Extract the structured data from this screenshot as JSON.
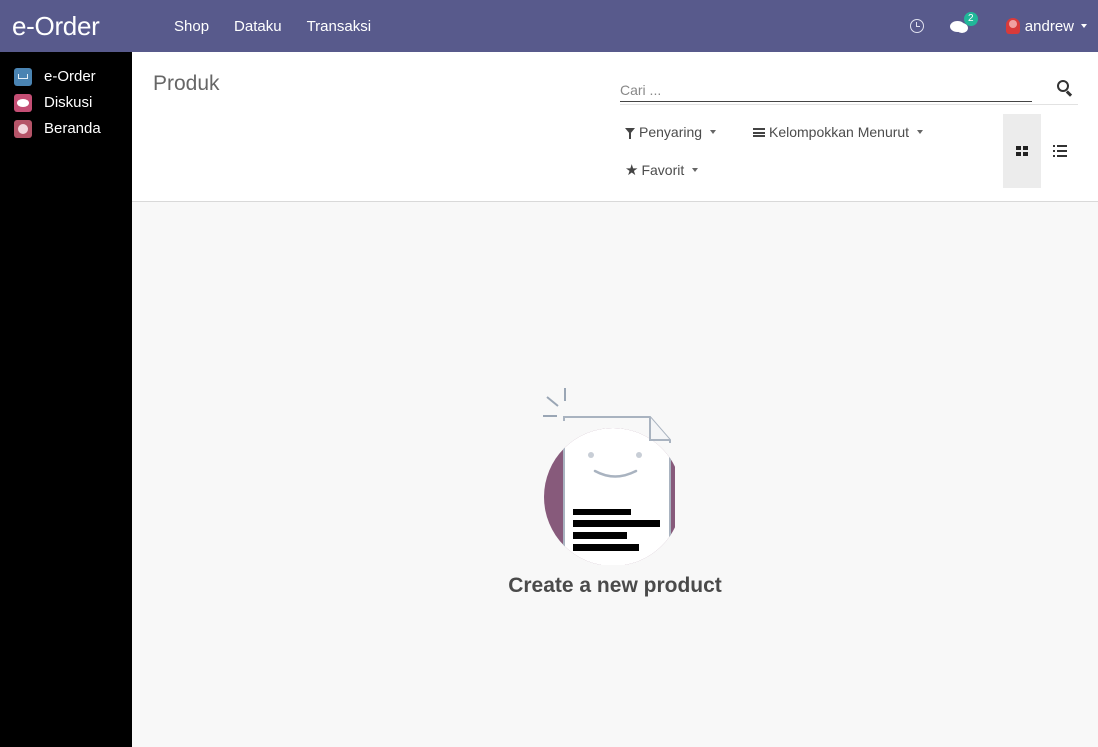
{
  "navbar": {
    "brand": "e-Order",
    "menu": [
      "Shop",
      "Dataku",
      "Transaksi"
    ],
    "messages_badge": "2",
    "user_name": "andrew",
    "color": "#585a8c"
  },
  "sidebar": {
    "items": [
      {
        "label": "e-Order",
        "icon": "cart-icon"
      },
      {
        "label": "Diskusi",
        "icon": "chat-icon"
      },
      {
        "label": "Beranda",
        "icon": "home-icon"
      }
    ]
  },
  "control_panel": {
    "title": "Produk",
    "search_placeholder": "Cari ...",
    "filters": "Penyaring",
    "group_by": "Kelompokkan Menurut",
    "favorites": "Favorit",
    "active_view": "kanban"
  },
  "help": {
    "message": "Create a new product"
  }
}
